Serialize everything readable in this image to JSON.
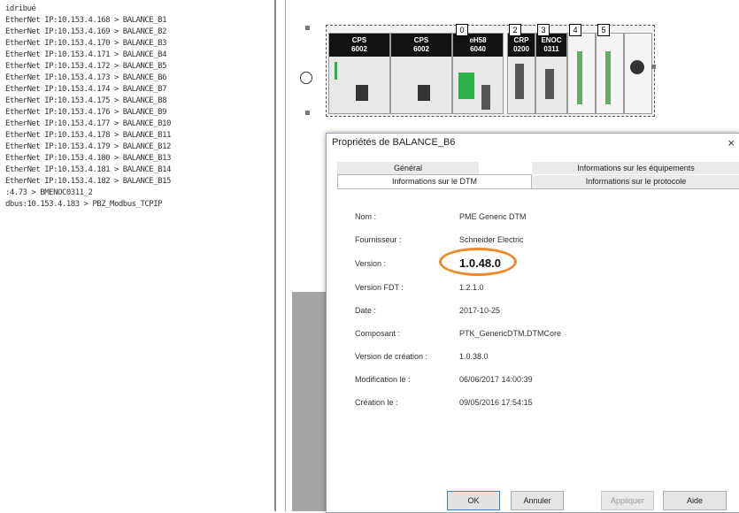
{
  "tree": {
    "items": [
      "idribué",
      "EtherNet IP:10.153.4.168 > BALANCE_B1",
      "EtherNet IP:10.153.4.169 > BALANCE_B2",
      "EtherNet IP:10.153.4.170 > BALANCE_B3",
      "EtherNet IP:10.153.4.171 > BALANCE_B4",
      "EtherNet IP:10.153.4.172 > BALANCE_B5",
      "EtherNet IP:10.153.4.173 > BALANCE_B6",
      "EtherNet IP:10.153.4.174 > BALANCE_B7",
      "EtherNet IP:10.153.4.175 > BALANCE_B8",
      "EtherNet IP:10.153.4.176 > BALANCE_B9",
      "EtherNet IP:10.153.4.177 > BALANCE_B10",
      "EtherNet IP:10.153.4.178 > BALANCE_B11",
      "EtherNet IP:10.153.4.179 > BALANCE_B12",
      "EtherNet IP:10.153.4.180 > BALANCE_B13",
      "EtherNet IP:10.153.4.181 > BALANCE_B14",
      "EtherNet IP:10.153.4.182 > BALANCE_B15",
      ":4.73 > BMENOC0311_2",
      "dbus:10.153.4.183 > PBZ_Modbus_TCPIP"
    ]
  },
  "rack": {
    "modules": [
      {
        "label": "CPS\n6002"
      },
      {
        "label": "CPS\n6002"
      },
      {
        "label": "eH58\n6040"
      },
      {
        "label": "CRP\n0200"
      },
      {
        "label": "ENOC\n0311"
      }
    ],
    "slots": [
      "0",
      "2",
      "3",
      "4",
      "5"
    ]
  },
  "dialog": {
    "title": "Propriétés de BALANCE_B6",
    "close": "×",
    "tabs": {
      "general": "Général",
      "equipment": "Informations sur les équipements",
      "dtm": "Informations sur le DTM",
      "protocol": "Informations sur le protocole"
    },
    "fields": {
      "nom_label": "Nom :",
      "nom_value": "PME Generic DTM",
      "fournisseur_label": "Fournisseur :",
      "fournisseur_value": "Schneider Electric",
      "version_label": "Version :",
      "version_value": "1.0.48.0",
      "fdt_label": "Version FDT :",
      "fdt_value": "1.2.1.0",
      "date_label": "Date :",
      "date_value": "2017-10-25",
      "composant_label": "Composant :",
      "composant_value": "PTK_GenericDTM.DTMCore",
      "creation_version_label": "Version de création :",
      "creation_version_value": "1.0.38.0",
      "modification_label": "Modification le :",
      "modification_value": "06/06/2017 14:00:39",
      "creation_label": "Création le :",
      "creation_value": "09/05/2016 17:54:15"
    },
    "buttons": {
      "ok": "OK",
      "cancel": "Annuler",
      "apply": "Appliquer",
      "help": "Aide"
    }
  },
  "colors": {
    "highlight_oval": "#f08a2a"
  }
}
